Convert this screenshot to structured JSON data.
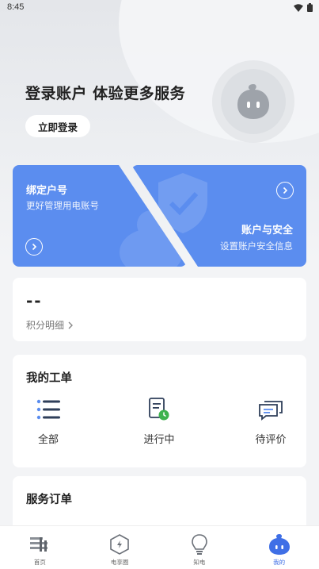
{
  "status_bar": {
    "time": "8:45"
  },
  "hero": {
    "title": "登录账户 体验更多服务",
    "login_button": "立即登录"
  },
  "cards": {
    "left": {
      "title": "绑定户号",
      "subtitle": "更好管理用电账号"
    },
    "right": {
      "title": "账户与安全",
      "subtitle": "设置账户安全信息"
    }
  },
  "points": {
    "value": "--",
    "link_label": "积分明细"
  },
  "work_orders": {
    "title": "我的工单",
    "items": [
      {
        "label": "全部",
        "icon": "list-icon"
      },
      {
        "label": "进行中",
        "icon": "document-clock-icon"
      },
      {
        "label": "待评价",
        "icon": "chat-icon"
      }
    ]
  },
  "service_orders": {
    "title": "服务订单"
  },
  "tabbar": {
    "items": [
      {
        "label": "首页",
        "icon": "home-icon",
        "active": false
      },
      {
        "label": "电享圈",
        "icon": "hexagon-icon",
        "active": false
      },
      {
        "label": "知电",
        "icon": "bulb-icon",
        "active": false
      },
      {
        "label": "我的",
        "icon": "mascot-icon",
        "active": true
      }
    ]
  },
  "colors": {
    "accent": "#5b8def",
    "tab_active": "#3f6fe6",
    "background": "#f3f4f6"
  }
}
